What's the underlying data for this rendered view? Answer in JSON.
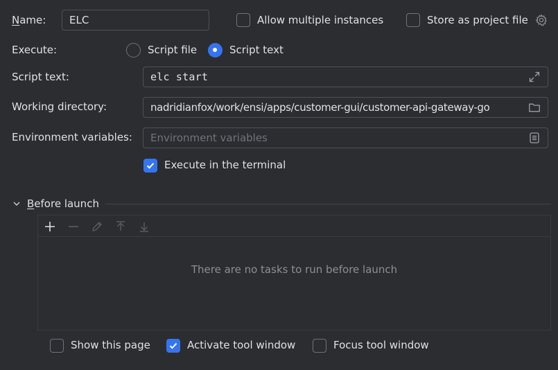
{
  "name": {
    "label": "Name:",
    "value": "ELC"
  },
  "allow_multiple": {
    "label": "Allow multiple instances",
    "checked": false
  },
  "store_project": {
    "label": "Store as project file",
    "checked": false,
    "icon": "gear-icon"
  },
  "execute": {
    "label": "Execute:",
    "options": [
      {
        "label": "Script file",
        "selected": false
      },
      {
        "label": "Script text",
        "selected": true
      }
    ]
  },
  "script_text": {
    "label": "Script text:",
    "value": "elc start",
    "icon": "expand-icon"
  },
  "working_directory": {
    "label": "Working directory:",
    "value": "nadridianfox/work/ensi/apps/customer-gui/customer-api-gateway-go",
    "icon": "folder-icon"
  },
  "env_vars": {
    "label": "Environment variables:",
    "placeholder": "Environment variables",
    "value": "",
    "icon": "document-list-icon"
  },
  "execute_terminal": {
    "label": "Execute in the terminal",
    "checked": true
  },
  "before_launch": {
    "title": "Before launch",
    "toolbar": [
      "add-icon",
      "remove-icon",
      "edit-icon",
      "move-up-icon",
      "move-down-icon"
    ],
    "empty_text": "There are no tasks to run before launch"
  },
  "footer": {
    "show_page": {
      "label": "Show this page",
      "checked": false
    },
    "activate_tool": {
      "label": "Activate tool window",
      "checked": true
    },
    "focus_tool": {
      "label": "Focus tool window",
      "checked": false
    }
  },
  "colors": {
    "background": "#2b2d30",
    "accent": "#3574f0",
    "border": "#4e5157",
    "text": "#dfe1e5",
    "muted": "#8c8f94"
  }
}
